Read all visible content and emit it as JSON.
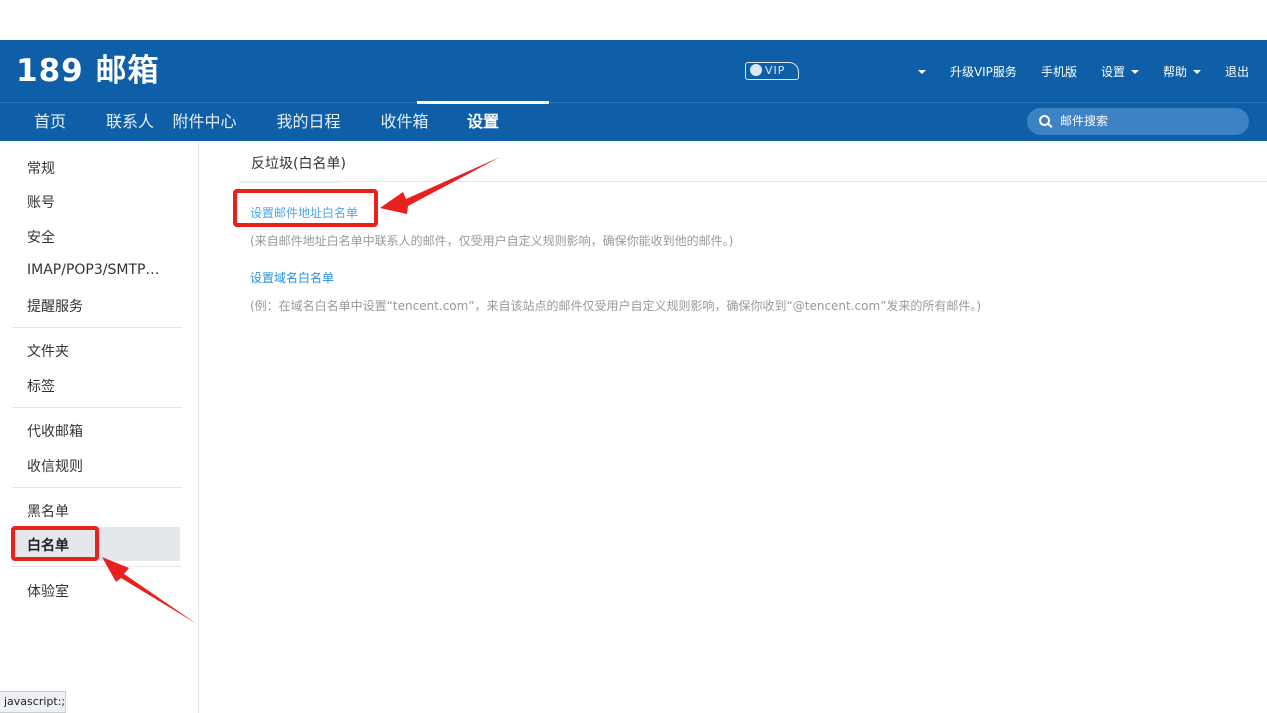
{
  "header": {
    "logo": "189 邮箱",
    "vip_badge": "VIP",
    "top_links": [
      "升级VIP服务",
      "手机版",
      "设置",
      "帮助",
      "退出"
    ]
  },
  "nav": {
    "tabs": [
      "首页",
      "联系人",
      "附件中心",
      "我的日程",
      "收件箱",
      "设置"
    ],
    "active_tab": "设置",
    "search_placeholder": "邮件搜索"
  },
  "sidebar": {
    "items": [
      "常规",
      "账号",
      "安全",
      "IMAP/POP3/SMTP…",
      "提醒服务",
      "文件夹",
      "标签",
      "代收邮箱",
      "收信规则",
      "黑名单",
      "白名单",
      "体验室"
    ],
    "active_item": "白名单"
  },
  "main": {
    "tab_title": "反垃圾(白名单)",
    "address_whitelist_link": "设置邮件地址白名单",
    "address_whitelist_desc": "(来自邮件地址白名单中联系人的邮件，仅受用户自定义规则影响，确保你能收到他的邮件。)",
    "domain_whitelist_link": "设置域名白名单",
    "domain_whitelist_desc": "(例：在域名白名单中设置“tencent.com”，来自该站点的邮件仅受用户自定义规则影响，确保你收到“@tencent.com”发来的所有邮件。)"
  },
  "status_bar": "javascript:;",
  "colors": {
    "header_bg": "#0e5fa8",
    "link": "#4aa8e6",
    "annotation_red": "#e8211f"
  }
}
